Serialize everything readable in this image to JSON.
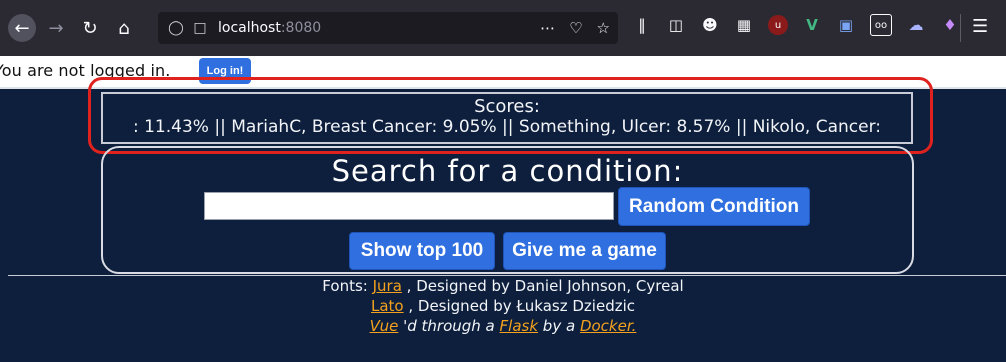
{
  "browser": {
    "url_host": "localhost",
    "url_port": ":8080",
    "menu_icon": "hamburger-menu-icon"
  },
  "login": {
    "status_text": "You are not logged in.",
    "button_label": "Log in!"
  },
  "scores": {
    "title": "Scores:",
    "ticker_text": ": 11.43% || MariahC, Breast Cancer: 9.05% || Something, Ulcer: 8.57% || Nikolo, Cancer:"
  },
  "search": {
    "title": "Search for a condition:",
    "input_value": "",
    "random_label": "Random Condition",
    "top_label": "Show top 100",
    "game_label": "Give me a game"
  },
  "footer": {
    "fonts_prefix": "Fonts: ",
    "font1_name": "Jura",
    "font1_credit": " , Designed by Daniel Johnson, Cyreal",
    "font2_name": "Lato",
    "font2_credit": " , Designed by Łukasz Dziedzic",
    "vue_link": "Vue",
    "through_text": " 'd through a ",
    "flask_link": "Flask",
    "by_text": " by a ",
    "docker_link": "Docker."
  },
  "colors": {
    "page_bg": "#0d1f3c",
    "button_blue": "#2f6fe0",
    "link_orange": "#f4a21e",
    "highlight_red": "#e0221f"
  }
}
